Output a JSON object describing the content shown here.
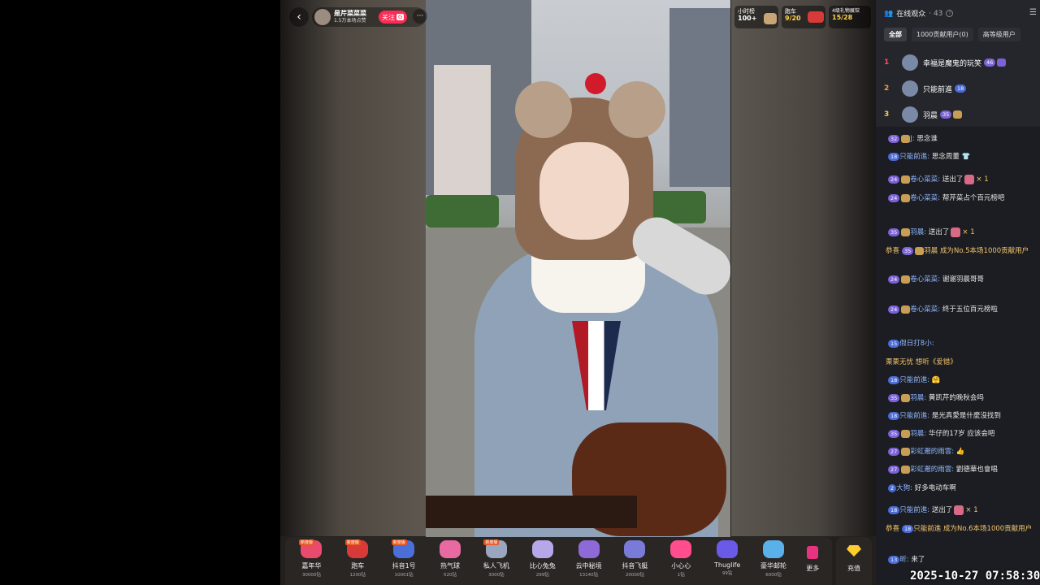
{
  "streamer": {
    "name": "是芹菜菜菜",
    "likes": "1.5万本场点赞",
    "follow_label": "关注",
    "follow_badge": "G",
    "more_label": "···",
    "back_icon": "chevron-left-icon"
  },
  "top_badges": [
    {
      "title": "小时榜",
      "value": "100+"
    },
    {
      "title": "跑车",
      "value": "9/20"
    },
    {
      "title": "4级礼物展馆",
      "value": "15/28"
    }
  ],
  "gifts": [
    {
      "name": "嘉年华",
      "price": "30000钻",
      "tag": "新度版",
      "color": "#e84b6b"
    },
    {
      "name": "跑车",
      "price": "1200钻",
      "tag": "新度版",
      "color": "#d83a3a"
    },
    {
      "name": "抖音1号",
      "price": "10001钻",
      "tag": "新度版",
      "color": "#4a6fd8"
    },
    {
      "name": "热气球",
      "price": "520钻",
      "tag": "",
      "color": "#e86aa0"
    },
    {
      "name": "私人飞机",
      "price": "3000钻",
      "tag": "新度版",
      "color": "#9aa6c0"
    },
    {
      "name": "比心兔兔",
      "price": "299钻",
      "tag": "",
      "color": "#b7a6e8"
    },
    {
      "name": "云中秘境",
      "price": "13140钻",
      "tag": "",
      "color": "#8d6ad8"
    },
    {
      "name": "抖音飞艇",
      "price": "20000钻",
      "tag": "",
      "color": "#7a7ad8"
    },
    {
      "name": "小心心",
      "price": "1钻",
      "tag": "",
      "color": "#ff4d8d"
    },
    {
      "name": "Thuglife",
      "price": "99钻",
      "tag": "",
      "color": "#6a5ae8"
    },
    {
      "name": "豪华邮轮",
      "price": "6000钻",
      "tag": "",
      "color": "#5ab0e8"
    }
  ],
  "gift_more_label": "更多",
  "recharge_label": "充值",
  "panel": {
    "title": "在线观众",
    "count": "· 43",
    "tabs": [
      "全部",
      "1000贡献用户(0)",
      "高等级用户"
    ],
    "ranks": [
      {
        "rank": "1",
        "name": "幸福是魔鬼的玩笑",
        "level": "46"
      },
      {
        "rank": "2",
        "name": "只能前進",
        "level": "18"
      },
      {
        "rank": "3",
        "name": "羽晨",
        "level": "35"
      }
    ]
  },
  "chat": [
    {
      "level": "32",
      "user": "J:",
      "text": "思念谁"
    },
    {
      "level": "18",
      "user": "只能前進:",
      "text": "思念周董 👕"
    },
    {
      "level": "24",
      "user": "卷心菜菜:",
      "text": "送出了",
      "suffix": "× 1"
    },
    {
      "level": "24",
      "user": "卷心菜菜:",
      "text": "帮芹菜占个百元榜吧"
    },
    {
      "level": "35",
      "user": "羽晨:",
      "text": "送出了",
      "suffix": "× 1"
    },
    {
      "prefix": "恭喜",
      "level": "35",
      "user": "羽晨",
      "text": "成为No.5本场1000贡献用户"
    },
    {
      "level": "24",
      "user": "卷心菜菜:",
      "text": "谢谢羽晨哥哥"
    },
    {
      "level": "24",
      "user": "卷心菜菜:",
      "text": "终于五位百元榜啦"
    },
    {
      "level": "15",
      "user": "假日打8小:",
      "text": ""
    },
    {
      "gold_line": "栗栗无忧 想听《爱错》"
    },
    {
      "level": "18",
      "user": "只能前進:",
      "text": "🤗"
    },
    {
      "level": "35",
      "user": "羽晨:",
      "text": "黄凯芹的晚秋会吗"
    },
    {
      "level": "18",
      "user": "只能前進:",
      "text": "是光真愛是什麼沒找到"
    },
    {
      "level": "35",
      "user": "羽晨:",
      "text": "华仔的17岁 应该会吧"
    },
    {
      "level": "27",
      "user": "彩虹邂的雨雲:",
      "text": "👍"
    },
    {
      "level": "27",
      "user": "彩虹邂的雨雲:",
      "text": "劉德華也會唱"
    },
    {
      "level": "2",
      "user": "大狗:",
      "text": "好多电动车啊"
    },
    {
      "level": "18",
      "user": "只能前進:",
      "text": "送出了",
      "suffix": "× 1"
    },
    {
      "prefix": "恭喜",
      "level": "18",
      "user": "只能前進",
      "text": "成为No.6本场1000贡献用户"
    },
    {
      "level": "13",
      "user": "昕:",
      "text": "来了"
    }
  ],
  "timestamp": "2025-10-27 07:58:30"
}
